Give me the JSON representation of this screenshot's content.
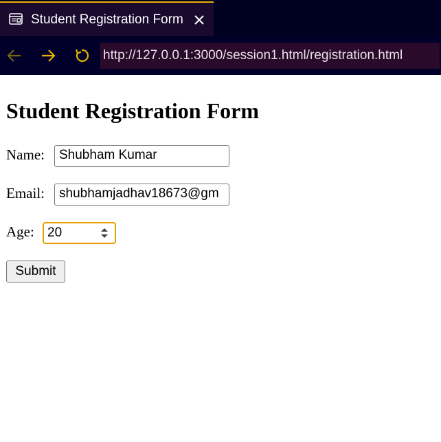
{
  "browser": {
    "tab": {
      "title": "Student Registration Form",
      "icon": "page-icon",
      "close_icon": "close-icon"
    },
    "nav": {
      "back_icon": "arrow-left-icon",
      "forward_icon": "arrow-right-icon",
      "reload_icon": "reload-icon"
    },
    "url": "http://127.0.0.1:3000/session1.html/registration.html",
    "colors": {
      "accent": "#e8b400",
      "tabbar_bg": "#000022",
      "tab_bg": "#1a0a2e",
      "urlbar_bg": "#2a0a2a"
    }
  },
  "form": {
    "heading": "Student Registration Form",
    "name_label": "Name:",
    "name_value": "Shubham Kumar",
    "email_label": "Email:",
    "email_value": "shubhamjadhav18673@gm",
    "age_label": "Age:",
    "age_value": "20",
    "submit_label": "Submit",
    "focus_color": "#e8a000"
  }
}
